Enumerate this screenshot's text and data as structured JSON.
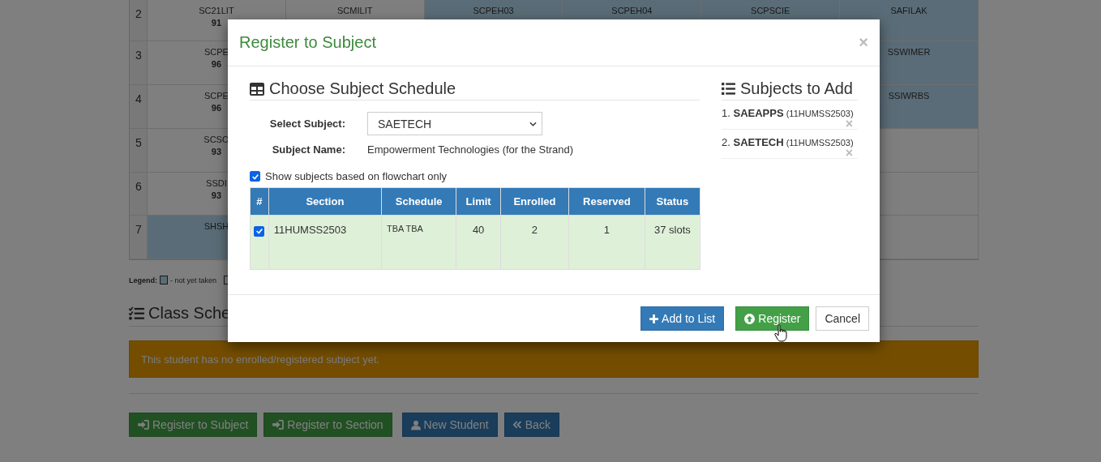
{
  "schedule_grid": {
    "rows": [
      {
        "number": "2",
        "cells": [
          {
            "code": "SC21LIT",
            "grade": "91",
            "taken": true
          },
          {
            "code": "SCMILIT",
            "taken": true
          },
          {
            "code": "SCPEH03",
            "taken": false
          },
          {
            "code": "SCPEH04",
            "taken": false
          },
          {
            "code": "SCPSCIE",
            "taken": false
          },
          {
            "code": "SAFILAK",
            "taken": false
          }
        ]
      },
      {
        "number": "3",
        "cells": [
          {
            "code": "SCPE",
            "grade": "96",
            "taken": true
          },
          {},
          {},
          {},
          {},
          {
            "code": "SSWIMER",
            "taken": false
          }
        ]
      },
      {
        "number": "4",
        "cells": [
          {
            "code": "SCPE",
            "grade": "96",
            "taken": true
          },
          {},
          {},
          {},
          {},
          {
            "code": "SSIWRBS",
            "taken": false
          }
        ]
      },
      {
        "number": "5",
        "cells": [
          {
            "code": "SCSO",
            "grade": "93",
            "taken": true
          },
          {},
          {},
          {},
          {},
          {
            "taken": true
          }
        ]
      },
      {
        "number": "6",
        "cells": [
          {
            "code": "SSDI",
            "grade": "93",
            "taken": true
          },
          {},
          {},
          {},
          {},
          {
            "taken": true
          }
        ]
      },
      {
        "number": "7",
        "cells": [
          {
            "code": "SHSH",
            "taken": false
          },
          {},
          {},
          {},
          {},
          {
            "taken": true
          }
        ]
      }
    ]
  },
  "legend": {
    "label": "Legend:",
    "items": [
      {
        "text": "- not yet taken",
        "taken": false
      },
      {
        "taken": true
      }
    ]
  },
  "class_schedule": {
    "heading": "Class Sche",
    "alert": "This student has no enrolled/registered subject yet."
  },
  "page_buttons": [
    {
      "label": "Register to Subject",
      "kind": "enter"
    },
    {
      "label": "Register to Section",
      "kind": "enter"
    },
    {
      "label": "New Student",
      "kind": "user"
    },
    {
      "label": "Back",
      "kind": "back"
    }
  ],
  "modal": {
    "title": "Register to Subject",
    "close": "×",
    "schedule_panel": {
      "heading": "Choose Subject Schedule",
      "select_subject": {
        "label": "Select Subject:",
        "value": "SAETECH"
      },
      "subject_name": {
        "label": "Subject Name:",
        "value": "Empowerment Technologies (for the Strand)"
      },
      "flowchart_only": {
        "label": "Show subjects based on flowchart only",
        "checked": true
      },
      "table": {
        "columns": [
          "#",
          "Section",
          "Schedule",
          "Limit",
          "Enrolled",
          "Reserved",
          "Status"
        ],
        "rows": [
          {
            "selected": true,
            "section": "11HUMSS2503",
            "schedule": "TBA TBA",
            "limit": "40",
            "enrolled": "2",
            "reserved": "1",
            "status": "37 slots"
          }
        ]
      }
    },
    "add_panel": {
      "heading": "Subjects to Add",
      "items": [
        {
          "number": "1.",
          "code": "SAEAPPS",
          "section": "(11HUMSS2503)",
          "remove": "×"
        },
        {
          "number": "2.",
          "code": "SAETECH",
          "section": "(11HUMSS2503)",
          "remove": "×"
        }
      ]
    },
    "buttons": [
      {
        "label": "Add to List",
        "kind": "plus"
      },
      {
        "label": "Register",
        "kind": "upload"
      },
      {
        "label": "Cancel",
        "kind": "plain"
      }
    ]
  }
}
